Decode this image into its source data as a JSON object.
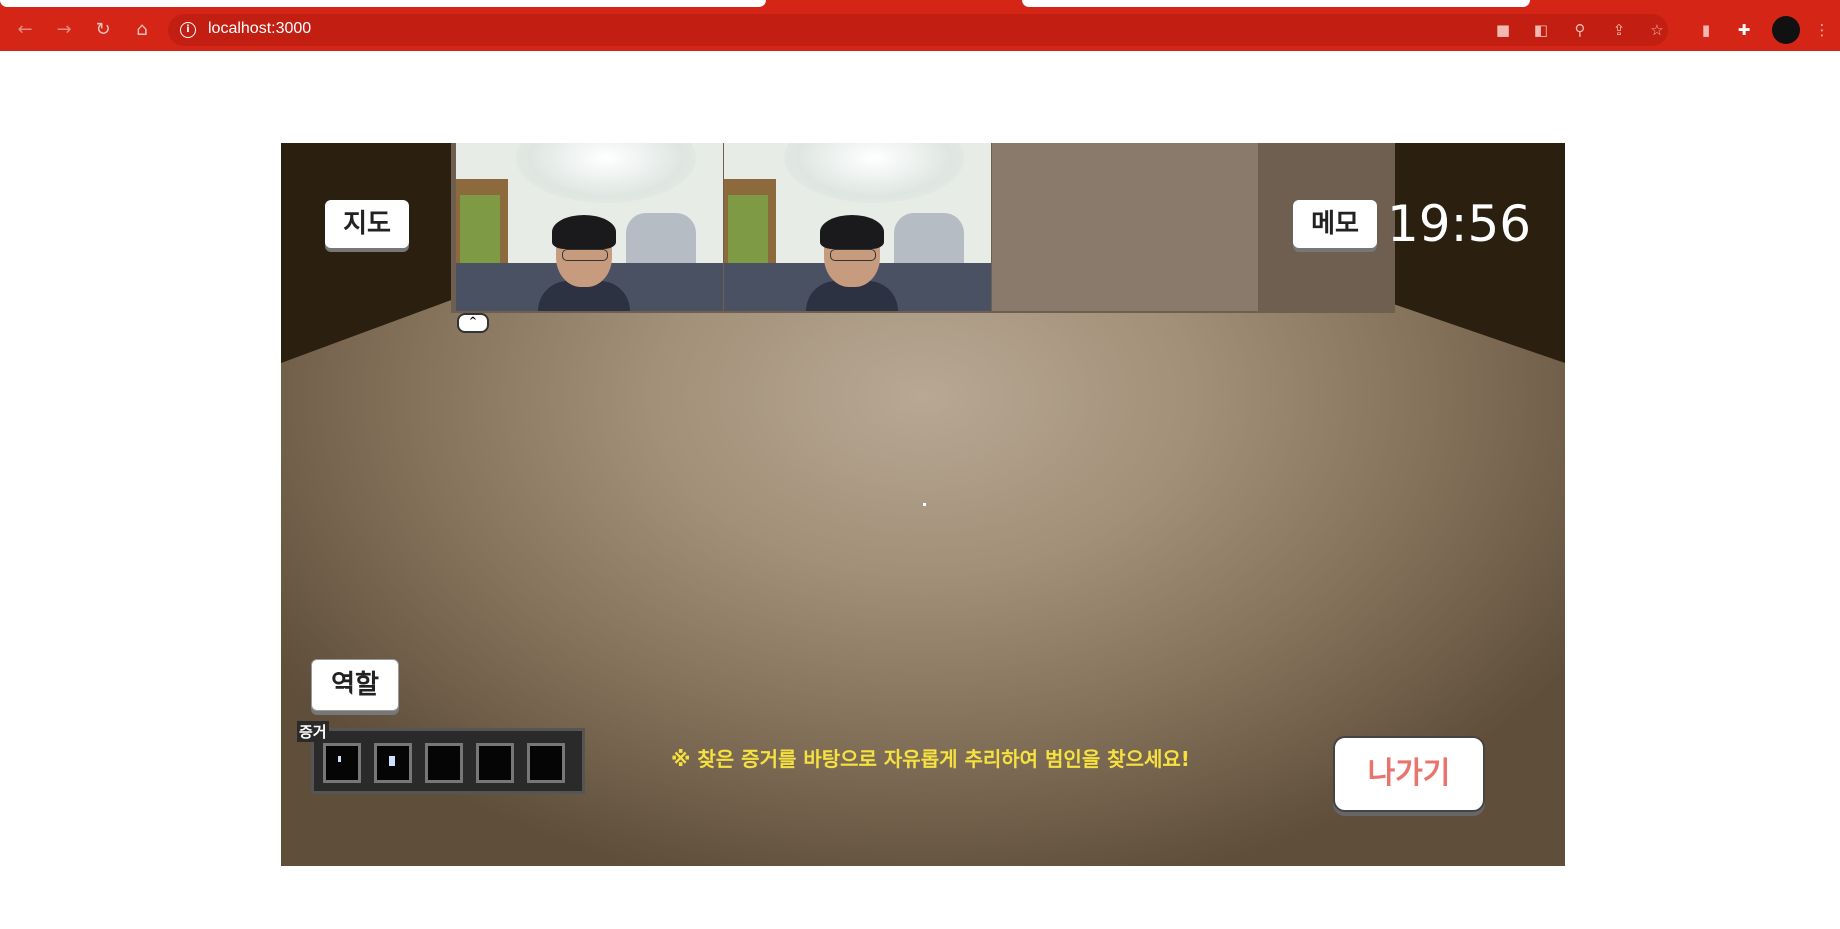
{
  "browser": {
    "url": "localhost:3000",
    "back_icon": "arrow-left-icon",
    "forward_icon": "arrow-right-icon",
    "reload_icon": "reload-icon",
    "home_icon": "home-icon",
    "accent_color": "#d42516"
  },
  "game": {
    "map_label": "지도",
    "memo_label": "메모",
    "timer": "19:56",
    "role_label": "역할",
    "exit_label": "나가기",
    "evidence_label": "증거",
    "evidence_slots": 5,
    "hint_text": "※ 찾은 증거를 바탕으로 자유롭게 추리하여 범인을 찾으세요!",
    "collapse_label": "^",
    "hint_color": "#f5e140",
    "exit_color": "#e8756d"
  }
}
